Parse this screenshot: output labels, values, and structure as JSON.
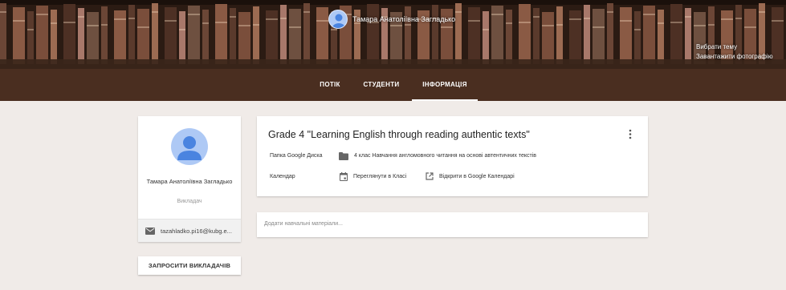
{
  "banner": {
    "teacher_name": "Тамара Анатоліївна Загладько",
    "select_theme": "Вибрати тему",
    "upload_photo": "Завантажити фотографію"
  },
  "nav": {
    "tabs": [
      {
        "label": "ПОТІК"
      },
      {
        "label": "СТУДЕНТИ"
      },
      {
        "label": "ІНФОРМАЦІЯ",
        "active": true
      }
    ]
  },
  "teacher_card": {
    "name": "Тамара Анатоліївна Загладько",
    "role": "Викладач",
    "email": "tazahladko.pi16@kubg.e..."
  },
  "invite_button": "ЗАПРОСИТИ ВИКЛАДАЧІВ",
  "about": {
    "title": "Grade 4 \"Learning English through reading authentic texts\"",
    "folder_label": "Папка Google Диска",
    "folder_value": "4 клас Навчання англомовного читання на основі автентичних текстів",
    "calendar_label": "Календар",
    "calendar_view": "Переглянути в Класі",
    "calendar_open": "Відкрити в Google Календарі"
  },
  "materials": {
    "placeholder": "Додати навчальні матеріали..."
  },
  "colors": {
    "navbar": "#4a2e20",
    "page_bg": "#f0ebe8",
    "avatar_bg": "#aec9f5",
    "avatar_fg": "#4a84e0"
  },
  "icons": [
    "person-avatar-icon",
    "mail-icon",
    "folder-icon",
    "calendar-icon",
    "open-external-icon",
    "more-vert-icon"
  ]
}
